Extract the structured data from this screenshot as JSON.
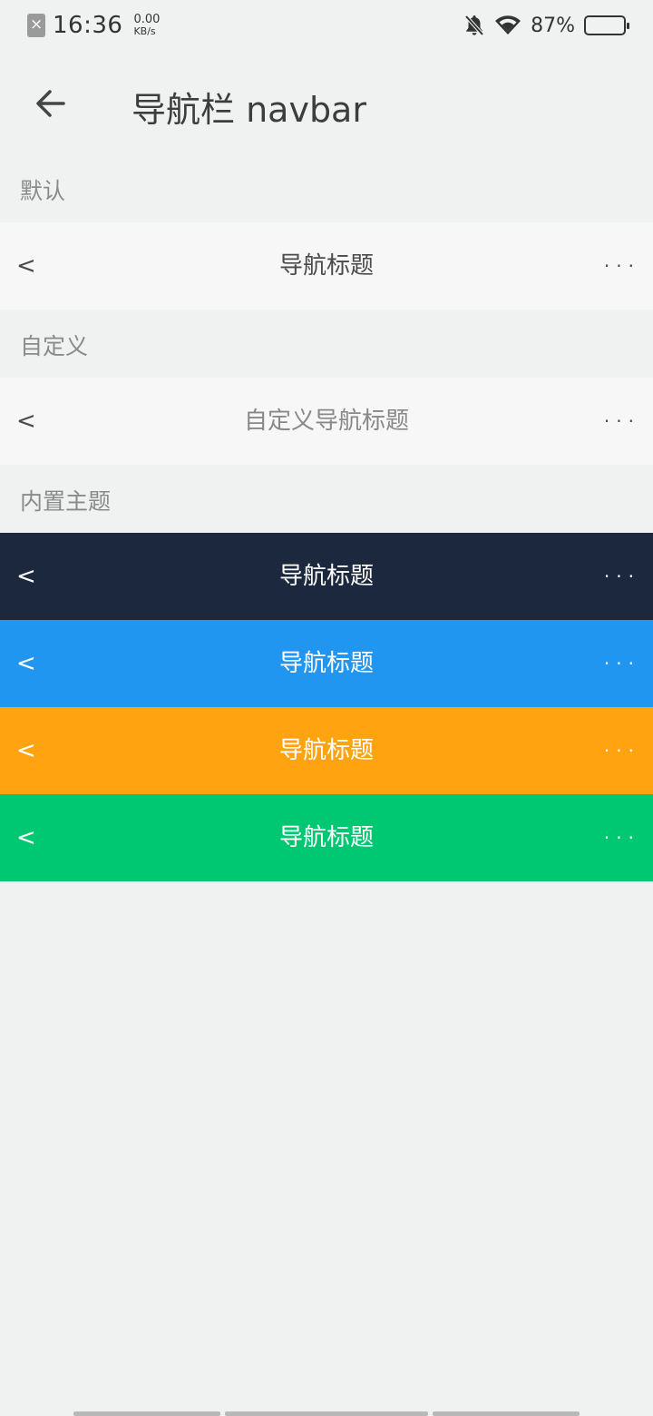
{
  "status_bar": {
    "time": "16:36",
    "speed_value": "0.00",
    "speed_unit": "KB/s",
    "battery_percent": "87%",
    "battery_level": 0.87
  },
  "header": {
    "title": "导航栏 navbar",
    "back_icon": "arrow-left-icon"
  },
  "sections": {
    "default_label": "默认",
    "custom_label": "自定义",
    "themes_label": "内置主题"
  },
  "navbars": {
    "default": {
      "back": "<",
      "title": "导航标题",
      "more": "···"
    },
    "custom": {
      "back": "<",
      "title": "自定义导航标题",
      "more": "···"
    },
    "themes": [
      {
        "back": "<",
        "title": "导航标题",
        "more": "···",
        "color": "#1b283e"
      },
      {
        "back": "<",
        "title": "导航标题",
        "more": "···",
        "color": "#2196f0"
      },
      {
        "back": "<",
        "title": "导航标题",
        "more": "···",
        "color": "#ffa311"
      },
      {
        "back": "<",
        "title": "导航标题",
        "more": "···",
        "color": "#00c872"
      }
    ]
  }
}
